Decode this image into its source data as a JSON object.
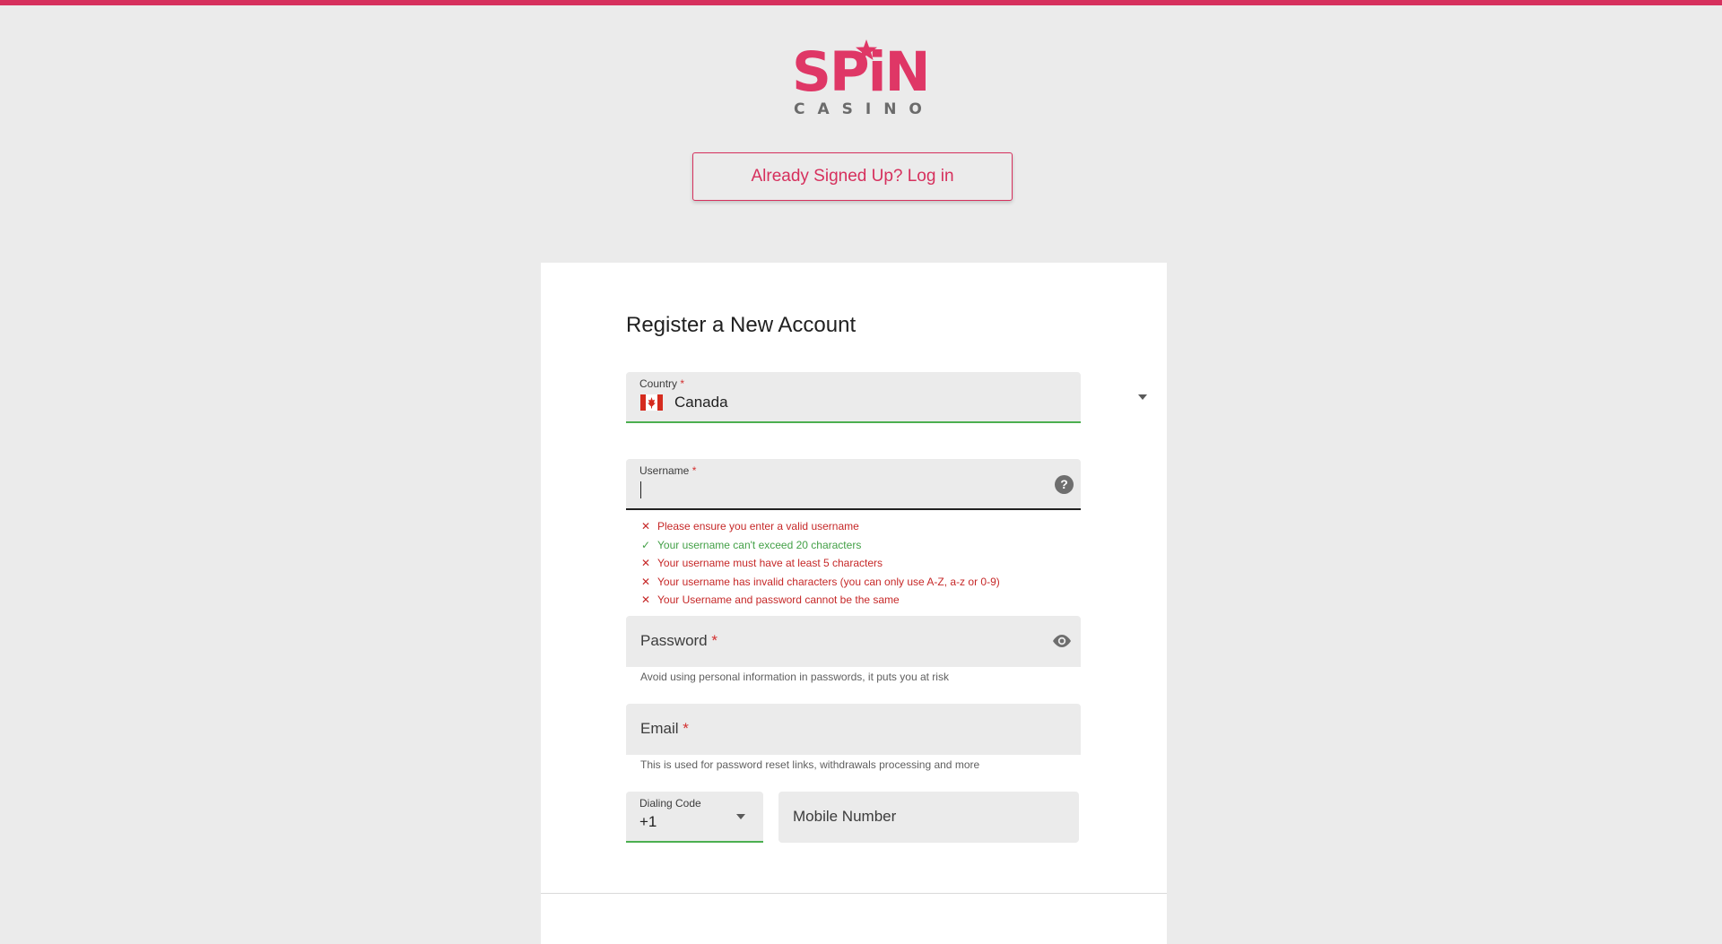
{
  "brand": {
    "logo_primary": "SPiN",
    "logo_secondary": "CASINO",
    "accent_color": "#d6305d"
  },
  "login_button": {
    "label": "Already Signed Up? Log in"
  },
  "form": {
    "title": "Register a New Account",
    "country": {
      "label": "Country",
      "required_mark": "*",
      "value": "Canada",
      "flag_icon": "canada-flag-icon"
    },
    "username": {
      "label": "Username",
      "required_mark": "*",
      "value": "",
      "help_icon": "question-circle-icon",
      "rules": [
        {
          "status": "error",
          "text": "Please ensure you enter a valid username"
        },
        {
          "status": "ok",
          "text": "Your username can't exceed 20 characters"
        },
        {
          "status": "error",
          "text": "Your username must have at least 5 characters"
        },
        {
          "status": "error",
          "text": "Your username has invalid characters (you can only use A-Z, a-z or 0-9)"
        },
        {
          "status": "error",
          "text": "Your Username and password cannot be the same"
        }
      ]
    },
    "password": {
      "label": "Password",
      "required_mark": "*",
      "hint": "Avoid using personal information in passwords, it puts you at risk",
      "toggle_icon": "eye-icon"
    },
    "email": {
      "label": "Email",
      "required_mark": "*",
      "hint": "This is used for password reset links, withdrawals processing and more"
    },
    "dialing_code": {
      "label": "Dialing Code",
      "value": "+1"
    },
    "mobile": {
      "placeholder": "Mobile Number"
    }
  },
  "colors": {
    "error": "#c62828",
    "success": "#43a047",
    "valid_underline": "#4caf50"
  }
}
